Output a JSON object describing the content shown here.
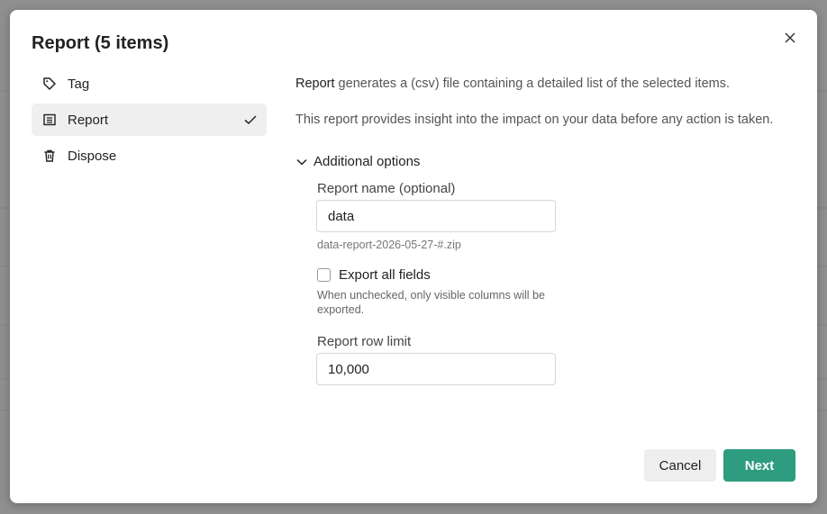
{
  "dialog": {
    "title": "Report (5 items)"
  },
  "sidebar": {
    "items": [
      {
        "label": "Tag",
        "icon": "tag-icon",
        "active": false
      },
      {
        "label": "Report",
        "icon": "report-icon",
        "active": true
      },
      {
        "label": "Dispose",
        "icon": "trash-icon",
        "active": false
      }
    ]
  },
  "content": {
    "description_bold": "Report",
    "description_rest": " generates a (csv) file containing a detailed list of the selected items.",
    "insight": "This report provides insight into the impact on your data before any action is taken.",
    "additional_options_label": "Additional options",
    "report_name_label": "Report name (optional)",
    "report_name_value": "data",
    "report_name_hint": "data-report-2026-05-27-#.zip",
    "export_all_label": "Export all fields",
    "export_all_checked": false,
    "export_all_note": "When unchecked, only visible columns will be exported.",
    "row_limit_label": "Report row limit",
    "row_limit_value": "10,000"
  },
  "footer": {
    "cancel_label": "Cancel",
    "next_label": "Next"
  },
  "colors": {
    "primary": "#2e9c7f",
    "active_bg": "#efefef",
    "backdrop": "#8f8f8f"
  }
}
